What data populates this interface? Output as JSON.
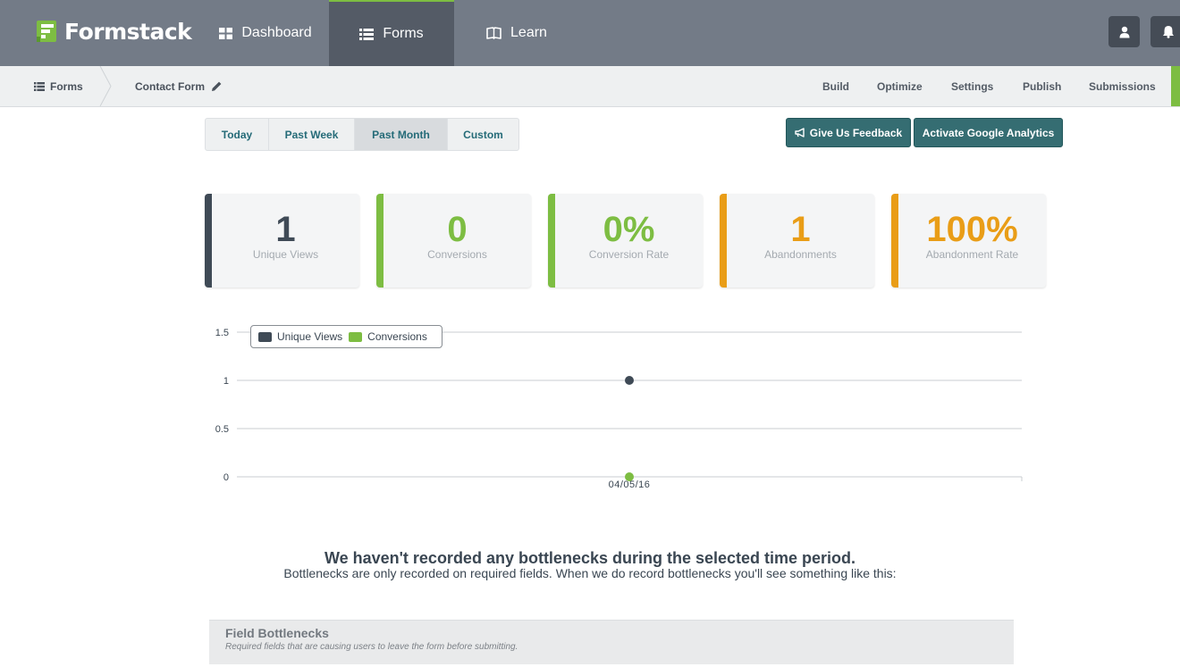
{
  "brand": {
    "name": "Formstack"
  },
  "nav": {
    "dashboard": "Dashboard",
    "forms": "Forms",
    "learn": "Learn"
  },
  "breadcrumb": {
    "forms": "Forms",
    "current": "Contact Form"
  },
  "subnav": [
    "Build",
    "Optimize",
    "Settings",
    "Publish",
    "Submissions"
  ],
  "date_range": {
    "options": [
      "Today",
      "Past Week",
      "Past Month",
      "Custom"
    ],
    "selected": "Past Month"
  },
  "actions": {
    "feedback": "Give Us Feedback",
    "analytics": "Activate Google Analytics"
  },
  "stats": [
    {
      "value": "1",
      "label": "Unique Views",
      "color": "#3f4a56"
    },
    {
      "value": "0",
      "label": "Conversions",
      "color": "#7dbd42"
    },
    {
      "value": "0%",
      "label": "Conversion Rate",
      "color": "#7dbd42"
    },
    {
      "value": "1",
      "label": "Abandonments",
      "color": "#e99d17"
    },
    {
      "value": "100%",
      "label": "Abandonment Rate",
      "color": "#e99d17"
    }
  ],
  "chart_data": {
    "type": "scatter",
    "x": [
      "04/05/16"
    ],
    "series": [
      {
        "name": "Unique Views",
        "values": [
          1
        ],
        "color": "#3f4a56"
      },
      {
        "name": "Conversions",
        "values": [
          0
        ],
        "color": "#7dbd42"
      }
    ],
    "y_ticks": [
      "0",
      "0.5",
      "1",
      "1.5"
    ],
    "ylim": [
      0,
      1.5
    ],
    "grid": true,
    "legend": "top-left"
  },
  "bottlenecks": {
    "title": "We haven't recorded any bottlenecks during the selected time period.",
    "subtitle": "Bottlenecks are only recorded on required fields. When we do record bottlenecks you'll see something like this:",
    "box_title": "Field Bottlenecks",
    "box_desc": "Required fields that are causing users to leave the form before submitting."
  }
}
